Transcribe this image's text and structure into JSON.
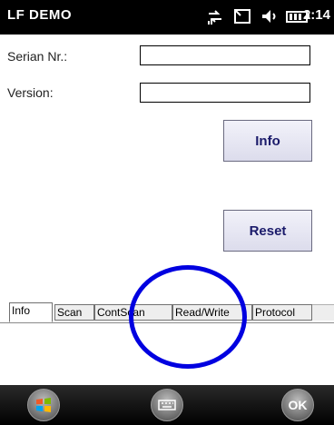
{
  "statusbar": {
    "app_title": "LF DEMO",
    "time": "2:14",
    "icons": [
      "connectivity-icon",
      "signal-icon",
      "volume-icon",
      "battery-icon"
    ]
  },
  "form": {
    "serial_label": "Serian Nr.:",
    "serial_value": "",
    "version_label": "Version:",
    "version_value": ""
  },
  "buttons": {
    "info": "Info",
    "reset": "Reset"
  },
  "tabs": [
    {
      "label": "Info",
      "active": true
    },
    {
      "label": "Scan",
      "active": false
    },
    {
      "label": "ContScan",
      "active": false
    },
    {
      "label": "Read/Write",
      "active": false
    },
    {
      "label": "Protocol",
      "active": false
    }
  ],
  "softkeys": {
    "start": "windows-start-icon",
    "keyboard": "keyboard-icon",
    "ok_label": "OK"
  },
  "colors": {
    "annotation": "#0000e0",
    "statusbar_bg": "#000000",
    "button_text": "#1a1a6a"
  }
}
